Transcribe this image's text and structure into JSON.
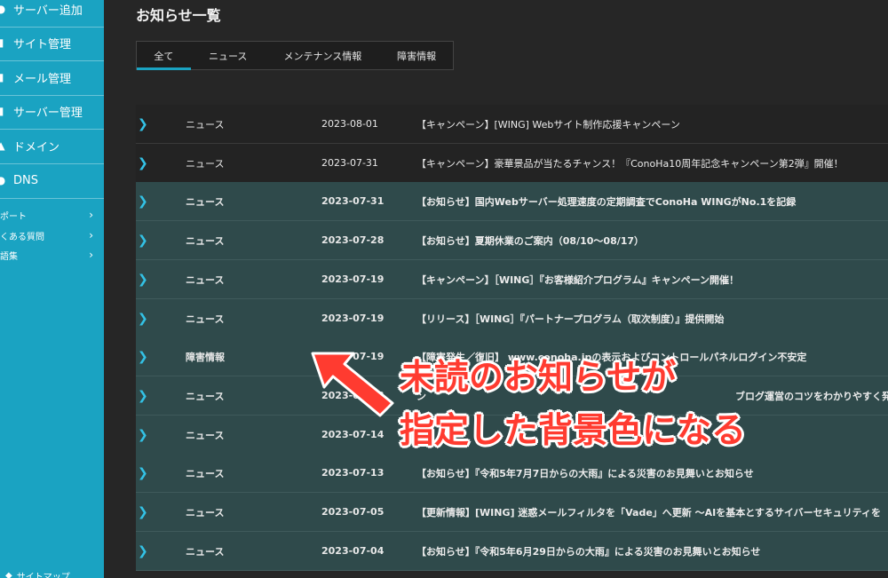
{
  "sidebar": {
    "items": [
      {
        "label": "サーバー追加",
        "icon": "server-add-icon"
      },
      {
        "label": "サイト管理",
        "icon": "site-icon"
      },
      {
        "label": "メール管理",
        "icon": "mail-icon"
      },
      {
        "label": "サーバー管理",
        "icon": "server-icon"
      },
      {
        "label": "ドメイン",
        "icon": "domain-icon"
      },
      {
        "label": "DNS",
        "icon": "dns-icon"
      }
    ],
    "links": [
      {
        "label": "ポート"
      },
      {
        "label": "くある質問"
      },
      {
        "label": "語集"
      }
    ],
    "bottom": {
      "label": "サイトマップ"
    }
  },
  "page": {
    "title": "お知らせ一覧"
  },
  "tabs": [
    {
      "label": "全て",
      "active": true
    },
    {
      "label": "ニュース",
      "active": false
    },
    {
      "label": "メンテナンス情報",
      "active": false
    },
    {
      "label": "障害情報",
      "active": false
    }
  ],
  "news": [
    {
      "category": "ニュース",
      "date": "2023-08-01",
      "title": "【キャンペーン】[WING] Webサイト制作応援キャンペーン",
      "unread": false
    },
    {
      "category": "ニュース",
      "date": "2023-07-31",
      "title": "【キャンペーン】豪華景品が当たるチャンス！『ConoHa10周年記念キャンペーン第2弾』開催！",
      "unread": false
    },
    {
      "category": "ニュース",
      "date": "2023-07-31",
      "title": "【お知らせ】国内Webサーバー処理速度の定期調査でConoHa WINGがNo.1を記録",
      "unread": true
    },
    {
      "category": "ニュース",
      "date": "2023-07-28",
      "title": "【お知らせ】夏期休業のご案内（08/10～08/17）",
      "unread": true
    },
    {
      "category": "ニュース",
      "date": "2023-07-19",
      "title": "【キャンペーン】［WING］『お客様紹介プログラム』キャンペーン開催！",
      "unread": true
    },
    {
      "category": "ニュース",
      "date": "2023-07-19",
      "title": "【リリース】［WING］『パートナープログラム（取次制度）』提供開始",
      "unread": true
    },
    {
      "category": "障害情報",
      "date": "2023-07-19",
      "title": "【障害発生／復旧】 www.conoha.jpの表示およびコントロールパネルログイン不安定",
      "unread": true
    },
    {
      "category": "ニュース",
      "date": "2023-07-18",
      "title": "",
      "unread": true
    },
    {
      "category": "ニュース",
      "date": "2023-07-14",
      "title": "",
      "unread": true
    },
    {
      "category": "ニュース",
      "date": "2023-07-13",
      "title": "【お知らせ】『令和5年7月7日からの大雨』による災害のお見舞いとお知らせ",
      "unread": true
    },
    {
      "category": "ニュース",
      "date": "2023-07-05",
      "title": "【更新情報】[WING] 迷惑メールフィルタを「Vade」へ更新 ～AIを基本とするサイバーセキュリティを",
      "unread": true
    },
    {
      "category": "ニュース",
      "date": "2023-07-04",
      "title": "【お知らせ】『令和5年6月29日からの大雨』による災害のお見舞いとお知らせ",
      "unread": true
    }
  ],
  "partial_titles": {
    "row8_tail": "ブログ運営のコツをわかりやすく発信～",
    "row8_left": "ン",
    "row9_left": "",
    "row9_tail": "ニ"
  },
  "annotation": {
    "line1": "未読のお知らせが",
    "line2": "指定した背景色になる",
    "color": "#ff3b30"
  },
  "colors": {
    "sidebar": "#1aa3c2",
    "background": "#262626",
    "unread_row": "#2f4a4b",
    "accent": "#33c2e6"
  }
}
